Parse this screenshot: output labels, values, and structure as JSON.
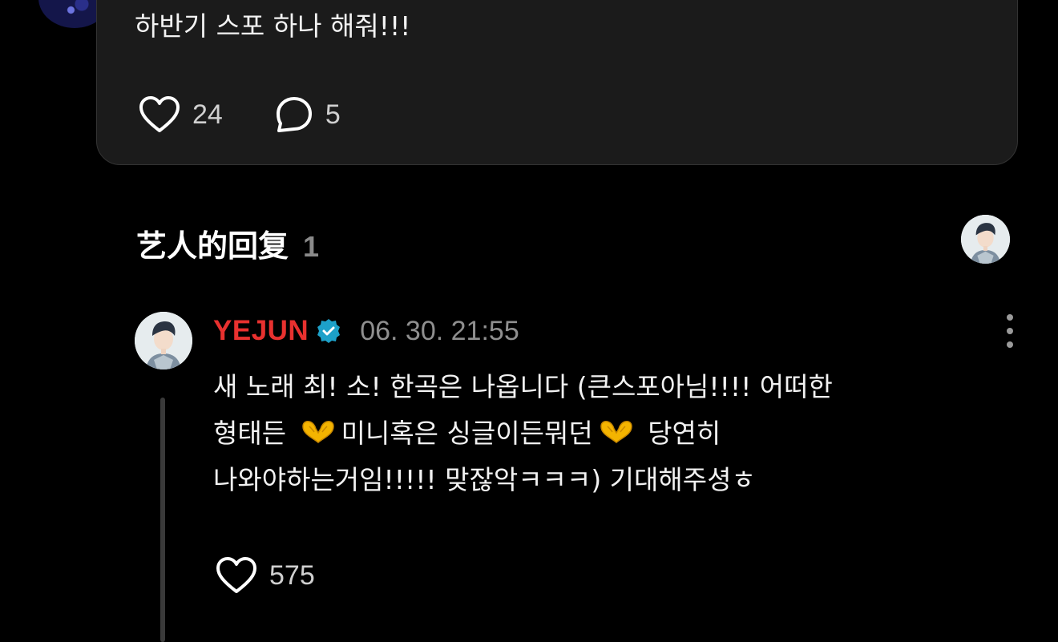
{
  "post": {
    "text": "하반기 스포 하나 해줘!!!",
    "likes": "24",
    "comments": "5"
  },
  "artist_replies": {
    "title": "艺人的回复",
    "count": "1"
  },
  "reply": {
    "author": "YEJUN",
    "timestamp": "06. 30. 21:55",
    "line1": "새 노래 최! 소! 한곡은 나옵니다 (큰스포아님!!!! 어떠한",
    "line2_a": "형태든",
    "line2_b": "미니혹은 싱글이든뭐던",
    "line2_c": "당연히",
    "line3": "나와야하는거임!!!!! 맞잖악ㅋㅋㅋ) 기대해주셩ㅎ",
    "likes": "575"
  },
  "colors": {
    "background": "#000000",
    "card": "#1b1b1b",
    "author_name": "#e8312f",
    "verified_badge": "#1da1c9",
    "secondary_text": "#8f8f8f"
  },
  "icons": {
    "like": "heart-outline-icon",
    "comment": "speech-bubble-icon",
    "verified": "verified-badge-icon",
    "more": "vertical-ellipsis-icon",
    "emoji": "heart-hands-emoji"
  }
}
